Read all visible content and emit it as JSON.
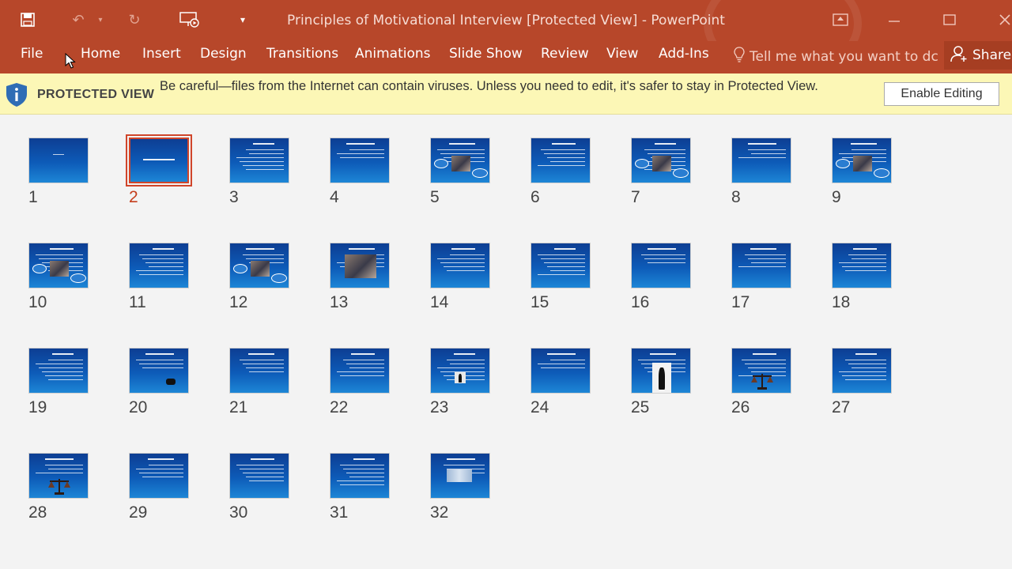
{
  "window": {
    "title": "Principles of Motivational Interview [Protected View] - PowerPoint"
  },
  "quick_access": {
    "icons": [
      "save-icon",
      "undo-icon",
      "redo-icon",
      "present-icon",
      "customize-icon"
    ]
  },
  "ribbon": {
    "tabs": [
      "File",
      "Home",
      "Insert",
      "Design",
      "Transitions",
      "Animations",
      "Slide Show",
      "Review",
      "View",
      "Add-Ins"
    ],
    "tell_me": "Tell me what you want to dc",
    "share": "Share"
  },
  "message_bar": {
    "label": "PROTECTED VIEW",
    "text": "Be careful—files from the Internet can contain viruses. Unless you need to edit, it's safer to stay in Protected View.",
    "button": "Enable Editing"
  },
  "slides": [
    {
      "n": "1"
    },
    {
      "n": "2"
    },
    {
      "n": "3"
    },
    {
      "n": "4"
    },
    {
      "n": "5"
    },
    {
      "n": "6"
    },
    {
      "n": "7"
    },
    {
      "n": "8"
    },
    {
      "n": "9"
    },
    {
      "n": "10"
    },
    {
      "n": "11"
    },
    {
      "n": "12"
    },
    {
      "n": "13"
    },
    {
      "n": "14"
    },
    {
      "n": "15"
    },
    {
      "n": "16"
    },
    {
      "n": "17"
    },
    {
      "n": "18"
    },
    {
      "n": "19"
    },
    {
      "n": "20"
    },
    {
      "n": "21"
    },
    {
      "n": "22"
    },
    {
      "n": "23"
    },
    {
      "n": "24"
    },
    {
      "n": "25"
    },
    {
      "n": "26"
    },
    {
      "n": "27"
    },
    {
      "n": "28"
    },
    {
      "n": "29"
    },
    {
      "n": "30"
    },
    {
      "n": "31"
    },
    {
      "n": "32"
    }
  ],
  "selected_slide": "2",
  "colors": {
    "accent": "#b7472a",
    "selection": "#d0452a",
    "message_bar": "#fcf7b6",
    "slide_blue": "#0d5bb8"
  }
}
